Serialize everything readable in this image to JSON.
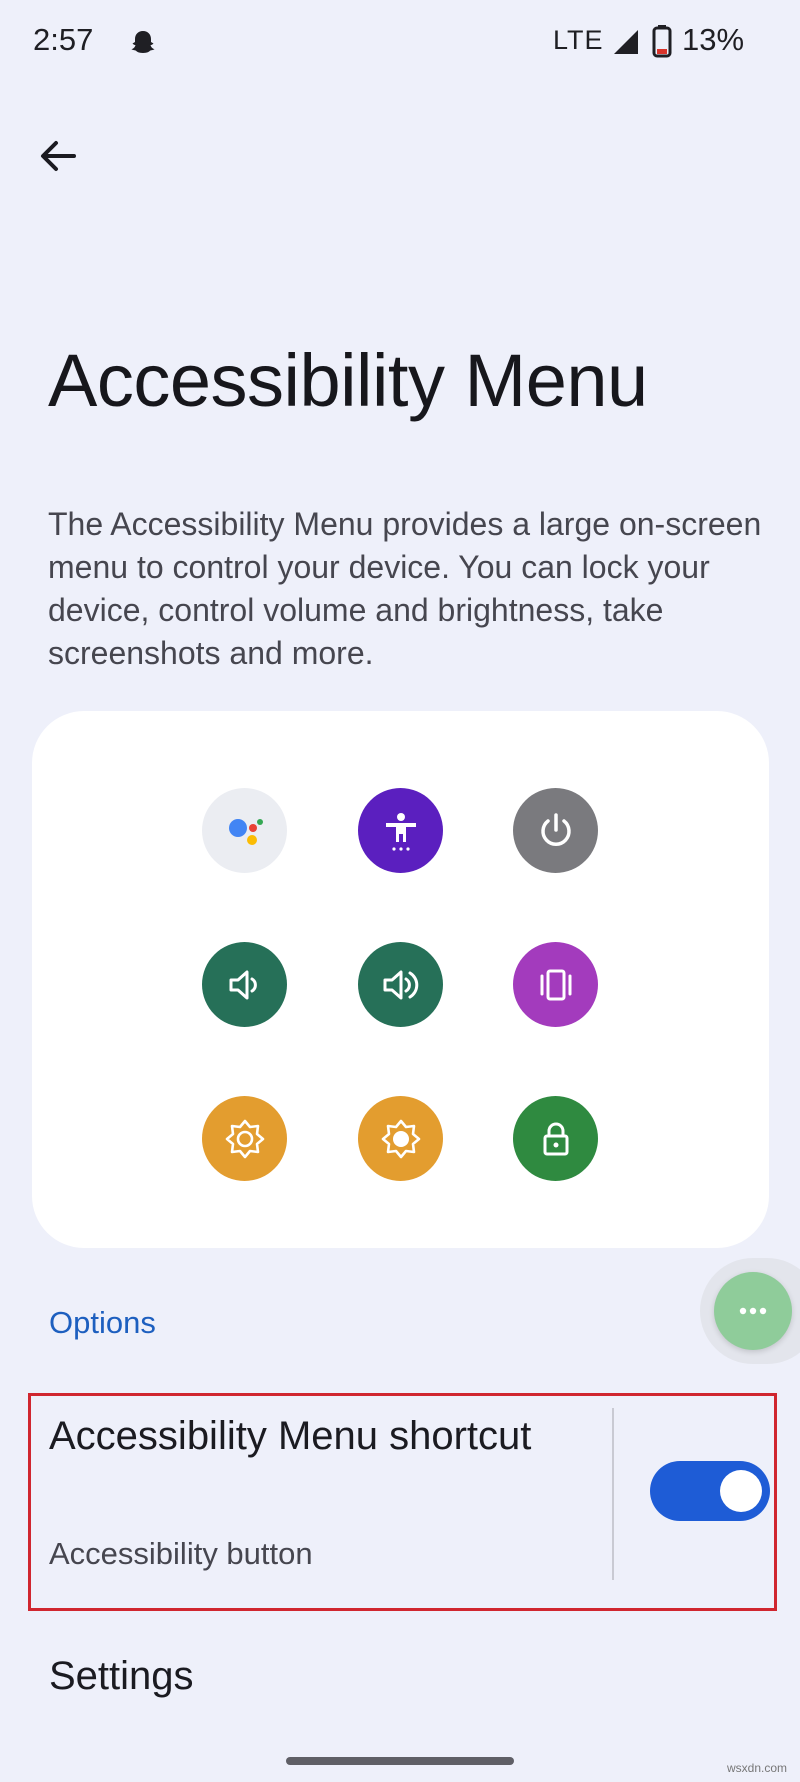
{
  "status_bar": {
    "time": "2:57",
    "notification_icon": "snapchat-ghost-icon",
    "network": "LTE",
    "battery": "13%"
  },
  "header": {
    "back_icon": "arrow-back-icon",
    "title": "Accessibility Menu"
  },
  "description": "The Accessibility Menu provides a large on-screen menu to control your device. You can lock your device, control volume and brightness, take screenshots and more.",
  "preview": {
    "tiles": [
      {
        "icon": "google-assistant-icon",
        "color": "#ebedf2"
      },
      {
        "icon": "accessibility-settings-icon",
        "color": "#5b1fbf"
      },
      {
        "icon": "power-icon",
        "color": "#7a7a7e"
      },
      {
        "icon": "volume-down-icon",
        "color": "#267058"
      },
      {
        "icon": "volume-up-icon",
        "color": "#267058"
      },
      {
        "icon": "recent-apps-icon",
        "color": "#a33bbd"
      },
      {
        "icon": "brightness-down-icon",
        "color": "#e39d2f"
      },
      {
        "icon": "brightness-up-icon",
        "color": "#e39d2f"
      },
      {
        "icon": "lock-icon",
        "color": "#2f8a40"
      }
    ]
  },
  "options": {
    "header": "Options",
    "shortcut": {
      "title": "Accessibility Menu shortcut",
      "subtitle": "Accessibility button",
      "enabled": true
    },
    "settings_label": "Settings"
  },
  "floating_button_icon": "more-horizontal-icon",
  "watermark": "wsxdn.com",
  "colors": {
    "background": "#eef0fa",
    "accent": "#1e5cd6",
    "options_header": "#1d5fbf",
    "highlight": "#d0262f"
  }
}
